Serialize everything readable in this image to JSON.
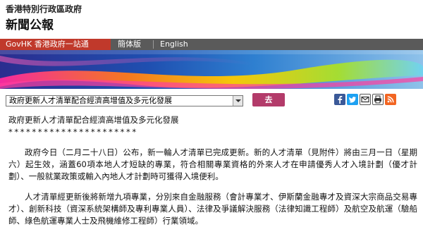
{
  "header": {
    "department": "香港特別行政區政府",
    "press_release": "新聞公報"
  },
  "nav": {
    "govhk": "GovHK 香港政府一站通",
    "simplified": "簡体版",
    "english": "English"
  },
  "toolbar": {
    "select_value": "政府更新人才清單配合經濟高增值及多元化發展",
    "go_label": "去",
    "tools": [
      "facebook-icon",
      "twitter-icon",
      "email-icon",
      "print-icon",
      "rss-icon"
    ]
  },
  "article": {
    "title": "政府更新人才清單配合經濟高增值及多元化發展",
    "stars": "**********************",
    "paragraphs": [
      "政府今日（二月二十八日）公布，新一輪人才清單已完成更新。新的人才清單（見附件）將由三月一日（星期六）起生效，涵蓋60項本地人才短缺的專業，符合相關專業資格的外來人才在申請優秀人才入境計劃（優才計劃）、一般就業政策或輸入內地人才計劃時可獲得入境便利。",
      "人才清單經更新後將新增九項專業，分別來自金融服務（會計專業才、伊斯蘭金融專才及資深大宗商品交易專才）、創新科技（資深系統架構師及專利專業人員）、法律及爭議解決服務（法律知識工程師）及航空及航運（驗船師、綠色航運專業人士及飛機維修工程師）行業領域。"
    ]
  },
  "colors": {
    "govhk_red": "#c0392b",
    "nav_gray": "#5a5a5a",
    "go_button": "#b33b6a"
  }
}
